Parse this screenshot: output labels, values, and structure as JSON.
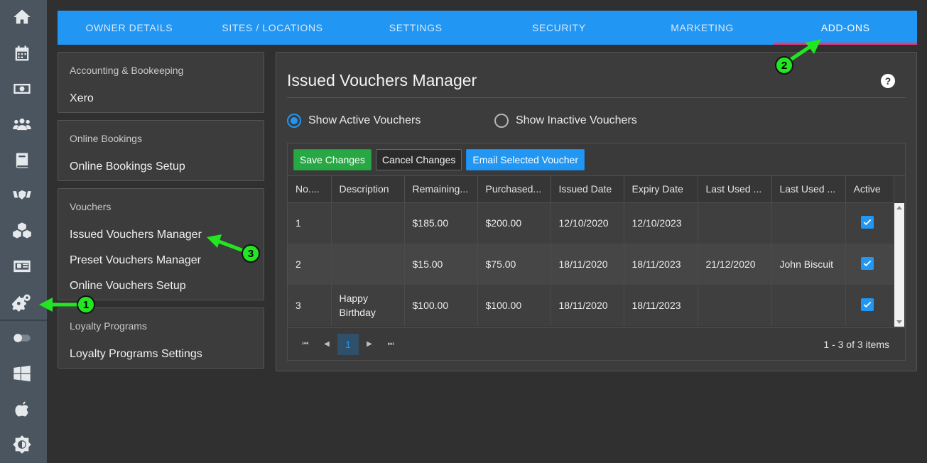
{
  "rail": {
    "icons": [
      "home-icon",
      "calendar-icon",
      "money-icon",
      "users-icon",
      "book-icon",
      "handshake-icon",
      "boxes-icon",
      "id-card-icon",
      "settings-gears-icon",
      "toggle-icon",
      "windows-icon",
      "apple-icon",
      "brightness-icon"
    ]
  },
  "tabs": [
    {
      "label": "OWNER DETAILS"
    },
    {
      "label": "SITES / LOCATIONS"
    },
    {
      "label": "SETTINGS"
    },
    {
      "label": "SECURITY"
    },
    {
      "label": "MARKETING"
    },
    {
      "label": "ADD-ONS"
    }
  ],
  "sidebar": {
    "accounting": {
      "heading": "Accounting & Bookeeping",
      "links": [
        "Xero"
      ]
    },
    "online_bookings": {
      "heading": "Online Bookings",
      "links": [
        "Online Bookings Setup"
      ]
    },
    "vouchers": {
      "heading": "Vouchers",
      "links": [
        "Issued Vouchers Manager",
        "Preset Vouchers Manager",
        "Online Vouchers Setup"
      ]
    },
    "loyalty": {
      "heading": "Loyalty Programs",
      "links": [
        "Loyalty Programs Settings"
      ]
    }
  },
  "main": {
    "title": "Issued Vouchers Manager",
    "help_glyph": "?",
    "radio_active": "Show Active Vouchers",
    "radio_inactive": "Show Inactive Vouchers",
    "buttons": {
      "save": "Save Changes",
      "cancel": "Cancel Changes",
      "email": "Email Selected Voucher"
    },
    "columns": [
      "No....",
      "Description",
      "Remaining...",
      "Purchased...",
      "Issued Date",
      "Expiry Date",
      "Last Used ...",
      "Last Used ...",
      "Active"
    ],
    "rows": [
      {
        "no": "1",
        "description": "",
        "remaining": "$185.00",
        "purchased": "$200.00",
        "issued": "12/10/2020",
        "expiry": "12/10/2023",
        "last_used_date": "",
        "last_used_by": "",
        "active": true
      },
      {
        "no": "2",
        "description": "",
        "remaining": "$15.00",
        "purchased": "$75.00",
        "issued": "18/11/2020",
        "expiry": "18/11/2023",
        "last_used_date": "21/12/2020",
        "last_used_by": "John Biscuit",
        "active": true
      },
      {
        "no": "3",
        "description": "Happy Birthday",
        "remaining": "$100.00",
        "purchased": "$100.00",
        "issued": "18/11/2020",
        "expiry": "18/11/2023",
        "last_used_date": "",
        "last_used_by": "",
        "active": true
      }
    ],
    "pager": {
      "current_page": "1",
      "info": "1 - 3 of 3 items"
    }
  },
  "annotations": {
    "badge1": "1",
    "badge2": "2",
    "badge3": "3",
    "color": "#22e622"
  }
}
